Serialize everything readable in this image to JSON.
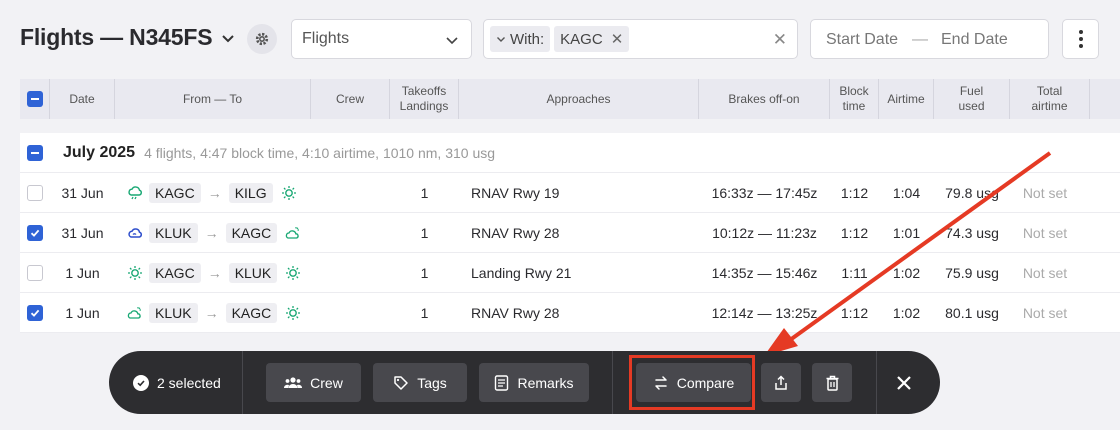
{
  "header": {
    "title": "Flights — N345FS",
    "view_dropdown": "Flights",
    "filter_chip_prefix": "With:",
    "filter_chip_value": "KAGC",
    "start_date_placeholder": "Start Date",
    "date_separator": "—",
    "end_date_placeholder": "End Date"
  },
  "columns": {
    "date": "Date",
    "from_to": "From — To",
    "crew": "Crew",
    "takeoffs": "Takeoffs",
    "landings": "Landings",
    "approaches": "Approaches",
    "brakes": "Brakes off-on",
    "block1": "Block",
    "block2": "time",
    "airtime": "Airtime",
    "fuel1": "Fuel",
    "fuel2": "used",
    "total1": "Total",
    "total2": "airtime"
  },
  "group": {
    "title": "July 2025",
    "summary": "4 flights, 4:47 block time, 4:10 airtime, 1010 nm, 310 usg"
  },
  "rows": [
    {
      "date": "31 Jun",
      "from": "KAGC",
      "to": "KILG",
      "takeoffs": "1",
      "approach": "RNAV Rwy 19",
      "brakes": "16:33z — 17:45z",
      "block": "1:12",
      "airtime": "1:04",
      "fuel": "79.8 usg",
      "total": "Not set",
      "checked": false
    },
    {
      "date": "31 Jun",
      "from": "KLUK",
      "to": "KAGC",
      "takeoffs": "1",
      "approach": "RNAV Rwy 28",
      "brakes": "10:12z — 11:23z",
      "block": "1:12",
      "airtime": "1:01",
      "fuel": "74.3 usg",
      "total": "Not set",
      "checked": true
    },
    {
      "date": "1 Jun",
      "from": "KAGC",
      "to": "KLUK",
      "takeoffs": "1",
      "approach": "Landing Rwy 21",
      "brakes": "14:35z — 15:46z",
      "block": "1:11",
      "airtime": "1:02",
      "fuel": "75.9 usg",
      "total": "Not set",
      "checked": false
    },
    {
      "date": "1 Jun",
      "from": "KLUK",
      "to": "KAGC",
      "takeoffs": "1",
      "approach": "RNAV Rwy 28",
      "brakes": "12:14z — 13:25z",
      "block": "1:12",
      "airtime": "1:02",
      "fuel": "80.1 usg",
      "total": "Not set",
      "checked": true
    }
  ],
  "actionbar": {
    "selected": "2 selected",
    "crew": "Crew",
    "tags": "Tags",
    "remarks": "Remarks",
    "compare": "Compare"
  },
  "colors": {
    "accent": "#2f63d6",
    "highlight": "#e53a24",
    "bar_bg": "#2d2d30"
  }
}
